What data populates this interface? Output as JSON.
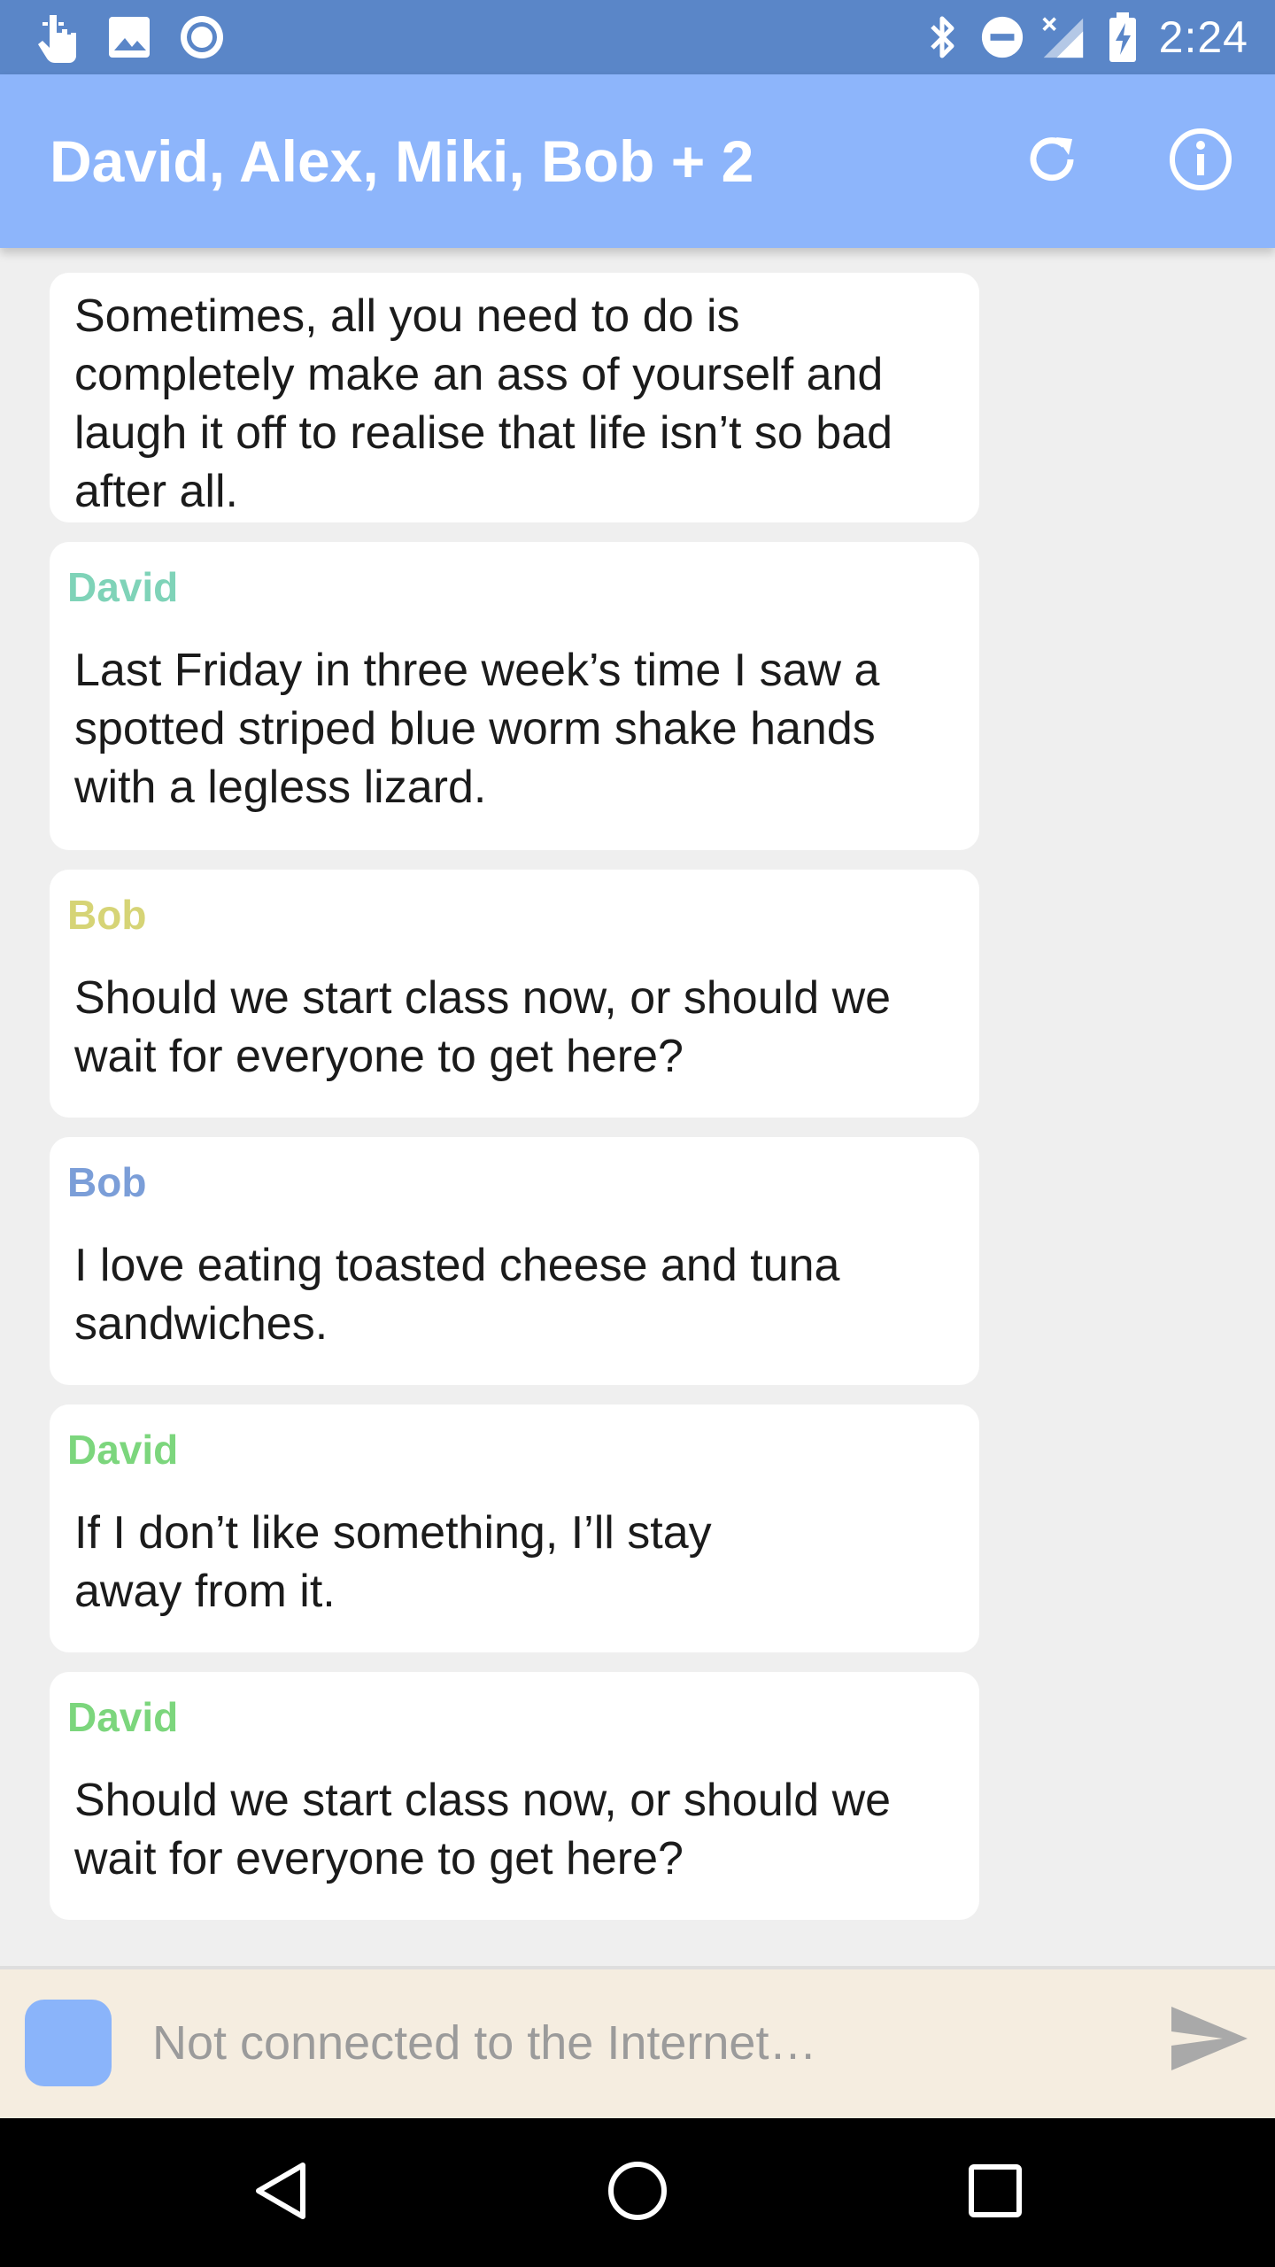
{
  "status_bar": {
    "time": "2:24",
    "left_icons": [
      "touch-icon",
      "image-icon",
      "record-icon"
    ],
    "right_icons": [
      "bluetooth-icon",
      "do-not-disturb-icon",
      "signal-icon",
      "battery-charging-icon"
    ]
  },
  "app_bar": {
    "title": "David, Alex, Miki, Bob + 2",
    "actions": [
      "refresh-icon",
      "info-icon"
    ],
    "color": "#8db5fb"
  },
  "messages": [
    {
      "sender": "",
      "text": "Sometimes, all you need to do is completely make an ass of yourself and laugh it off to realise that life isn’t so bad after all."
    },
    {
      "sender": "David",
      "sender_color": "#7fd3b8",
      "text": "Last Friday in three week’s time I saw a spotted striped blue worm shake hands with a legless lizard."
    },
    {
      "sender": "Bob",
      "sender_color": "#d6d476",
      "text": "Should we start class now, or should we wait for everyone to get here?"
    },
    {
      "sender": "Bob",
      "sender_color": "#7b9ed8",
      "text": "I love eating toasted cheese and tuna sandwiches."
    },
    {
      "sender": "David",
      "sender_color": "#7cd67d",
      "text": "If I don’t like something, I’ll stay away from it."
    },
    {
      "sender": "David",
      "sender_color": "#7cd67d",
      "text": "Should we start class now, or should we wait for everyone to get here?"
    }
  ],
  "composer": {
    "placeholder": "Not connected to the Internet…",
    "send_icon": "send-icon"
  },
  "nav_bar": {
    "buttons": [
      "back-icon",
      "home-icon",
      "recents-icon"
    ]
  }
}
